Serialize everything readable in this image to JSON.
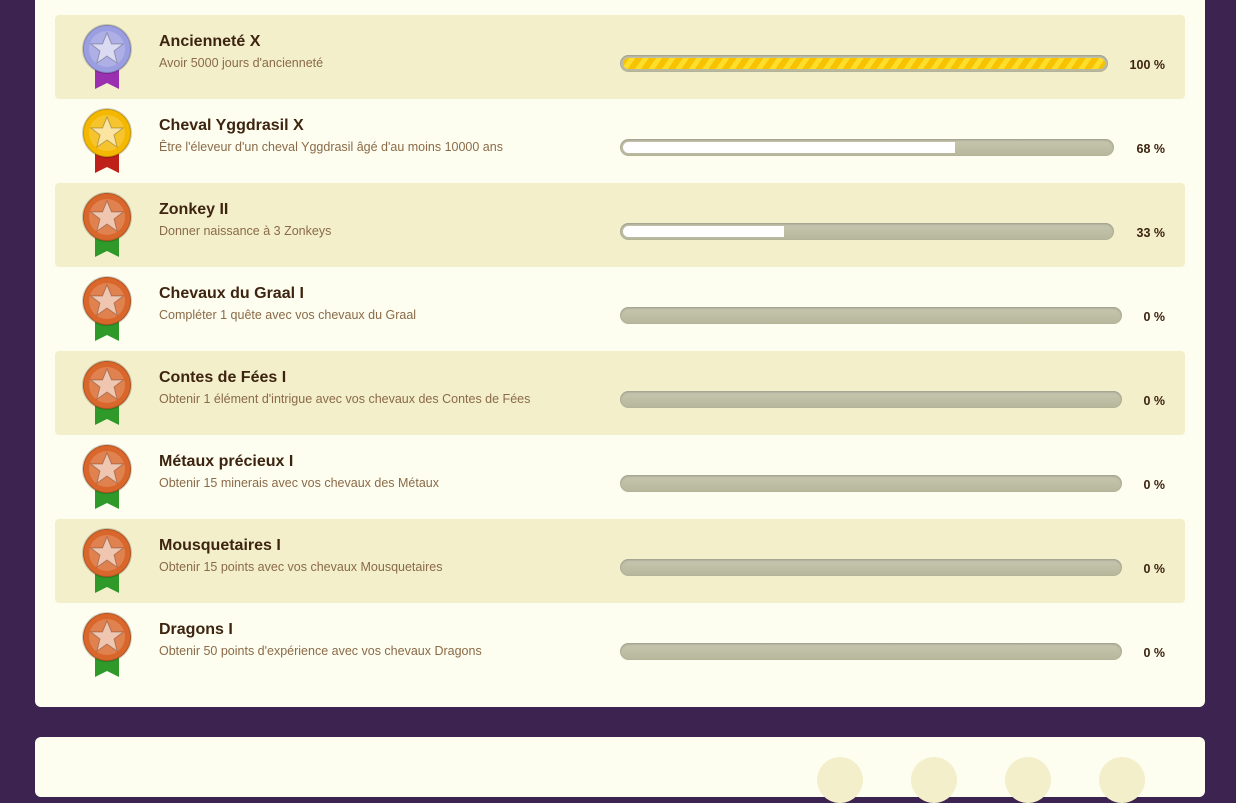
{
  "achievements": [
    {
      "title": "Ancienneté X",
      "description": "Avoir 5000 jours d'ancienneté",
      "progress_label": "100 %",
      "progress": 1.0,
      "medal": "medal-platinum-icon",
      "medal_color": "#9b9ee0",
      "ribbon_color": "#9a2fb0",
      "alt": true
    },
    {
      "title": "Cheval Yggdrasil X",
      "description": "Être l'éleveur d'un cheval Yggdrasil âgé d'au moins 10000 ans",
      "progress_label": "68 %",
      "progress": 0.68,
      "medal": "medal-gold-icon",
      "medal_color": "#f5b800",
      "ribbon_color": "#c0201a",
      "alt": false
    },
    {
      "title": "Zonkey II",
      "description": "Donner naissance à 3 Zonkeys",
      "progress_label": "33 %",
      "progress": 0.33,
      "medal": "medal-bronze-icon",
      "medal_color": "#d9662a",
      "ribbon_color": "#2f9a2a",
      "alt": true
    },
    {
      "title": "Chevaux du Graal I",
      "description": "Compléter 1 quête avec vos chevaux du Graal",
      "progress_label": "0 %",
      "progress": 0,
      "medal": "medal-bronze-icon",
      "medal_color": "#d9662a",
      "ribbon_color": "#2f9a2a",
      "alt": false
    },
    {
      "title": "Contes de Fées I",
      "description": "Obtenir 1 élément d'intrigue avec vos chevaux des Contes de Fées",
      "progress_label": "0 %",
      "progress": 0,
      "medal": "medal-bronze-icon",
      "medal_color": "#d9662a",
      "ribbon_color": "#2f9a2a",
      "alt": true
    },
    {
      "title": "Métaux précieux I",
      "description": "Obtenir 15 minerais avec vos chevaux des Métaux",
      "progress_label": "0 %",
      "progress": 0,
      "medal": "medal-bronze-icon",
      "medal_color": "#d9662a",
      "ribbon_color": "#2f9a2a",
      "alt": false
    },
    {
      "title": "Mousquetaires I",
      "description": "Obtenir 15 points avec vos chevaux Mousquetaires",
      "progress_label": "0 %",
      "progress": 0,
      "medal": "medal-bronze-icon",
      "medal_color": "#d9662a",
      "ribbon_color": "#2f9a2a",
      "alt": true
    },
    {
      "title": "Dragons I",
      "description": "Obtenir 50 points d'expérience avec vos chevaux Dragons",
      "progress_label": "0 %",
      "progress": 0,
      "medal": "medal-bronze-icon",
      "medal_color": "#d9662a",
      "ribbon_color": "#2f9a2a",
      "alt": false
    }
  ],
  "colors": {
    "page_background": "#3d2350",
    "panel_background": "#fefef0",
    "row_alt_background": "#f3efcb"
  }
}
